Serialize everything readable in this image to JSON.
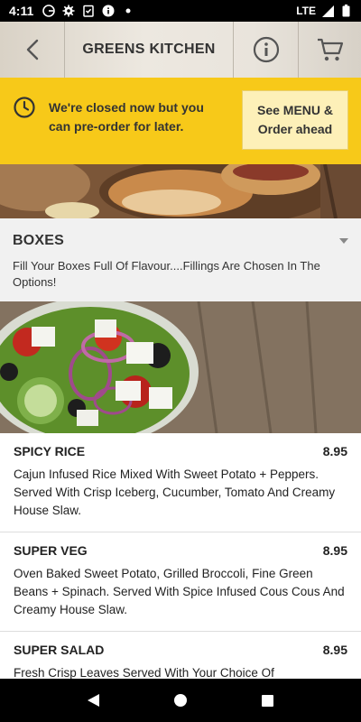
{
  "status_bar": {
    "time": "4:11",
    "network": "LTE",
    "icons": [
      "google-icon",
      "settings-icon",
      "clipboard-check-icon",
      "info-icon",
      "dot-icon",
      "signal-icon",
      "battery-icon"
    ]
  },
  "header": {
    "title": "GREENS KITCHEN",
    "icons": [
      "back-arrow-icon",
      "info-icon",
      "cart-icon"
    ]
  },
  "banner": {
    "message": "We're closed now but you can pre-order for later.",
    "button_label": "See MENU & Order ahead",
    "background_color": "#f7c919",
    "icon": "clock-icon"
  },
  "category": {
    "title": "BOXES",
    "description": "Fill Your Boxes Full Of Flavour....Fillings Are Chosen In The Options!",
    "icon": "chevron-down-icon"
  },
  "items": [
    {
      "name": "SPICY RICE",
      "price": "8.95",
      "description": "Cajun Infused Rice Mixed With Sweet Potato + Peppers. Served With Crisp Iceberg, Cucumber, Tomato And Creamy House Slaw."
    },
    {
      "name": "SUPER VEG",
      "price": "8.95",
      "description": "Oven Baked Sweet Potato, Grilled Broccoli, Fine Green Beans + Spinach. Served With Spice Infused Cous Cous And Creamy House Slaw."
    },
    {
      "name": "SUPER SALAD",
      "price": "8.95",
      "description": "Fresh Crisp Leaves Served With Your Choice Of"
    }
  ],
  "nav_bar": {
    "icons": [
      "nav-back-icon",
      "nav-home-icon",
      "nav-recents-icon"
    ]
  }
}
